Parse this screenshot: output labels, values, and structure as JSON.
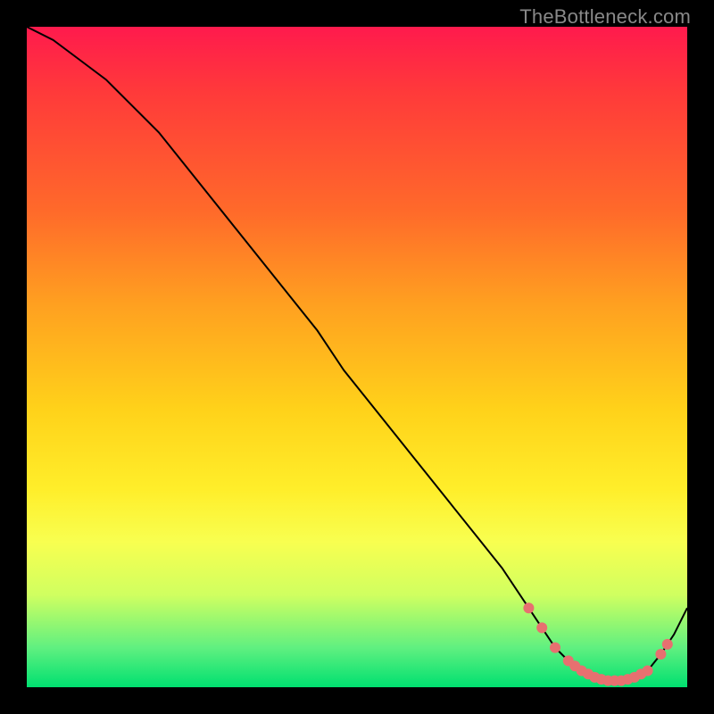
{
  "watermark": "TheBottleneck.com",
  "chart_data": {
    "type": "line",
    "title": "",
    "xlabel": "",
    "ylabel": "",
    "xlim": [
      0,
      100
    ],
    "ylim": [
      0,
      100
    ],
    "curve": {
      "name": "bottleneck-curve",
      "x": [
        0,
        4,
        8,
        12,
        16,
        20,
        24,
        28,
        32,
        36,
        40,
        44,
        48,
        52,
        56,
        60,
        64,
        68,
        72,
        76,
        78,
        80,
        82,
        84,
        86,
        88,
        90,
        92,
        94,
        96,
        98,
        100
      ],
      "y": [
        100,
        98,
        95,
        92,
        88,
        84,
        79,
        74,
        69,
        64,
        59,
        54,
        48,
        43,
        38,
        33,
        28,
        23,
        18,
        12,
        9,
        6,
        4,
        2.5,
        1.5,
        1,
        1,
        1.5,
        2.5,
        5,
        8,
        12
      ]
    },
    "markers": {
      "name": "trough-markers",
      "x": [
        76,
        78,
        80,
        82,
        83,
        84,
        85,
        86,
        87,
        88,
        89,
        90,
        91,
        92,
        93,
        94,
        96,
        97
      ],
      "y": [
        12,
        9,
        6,
        4,
        3.2,
        2.5,
        2,
        1.5,
        1.2,
        1,
        1,
        1,
        1.2,
        1.5,
        2,
        2.5,
        5,
        6.5
      ]
    },
    "colors": {
      "curve": "#000000",
      "marker": "#e77070",
      "gradient_top": "#ff1a4d",
      "gradient_mid": "#ffd21a",
      "gradient_bottom": "#00e070"
    }
  }
}
